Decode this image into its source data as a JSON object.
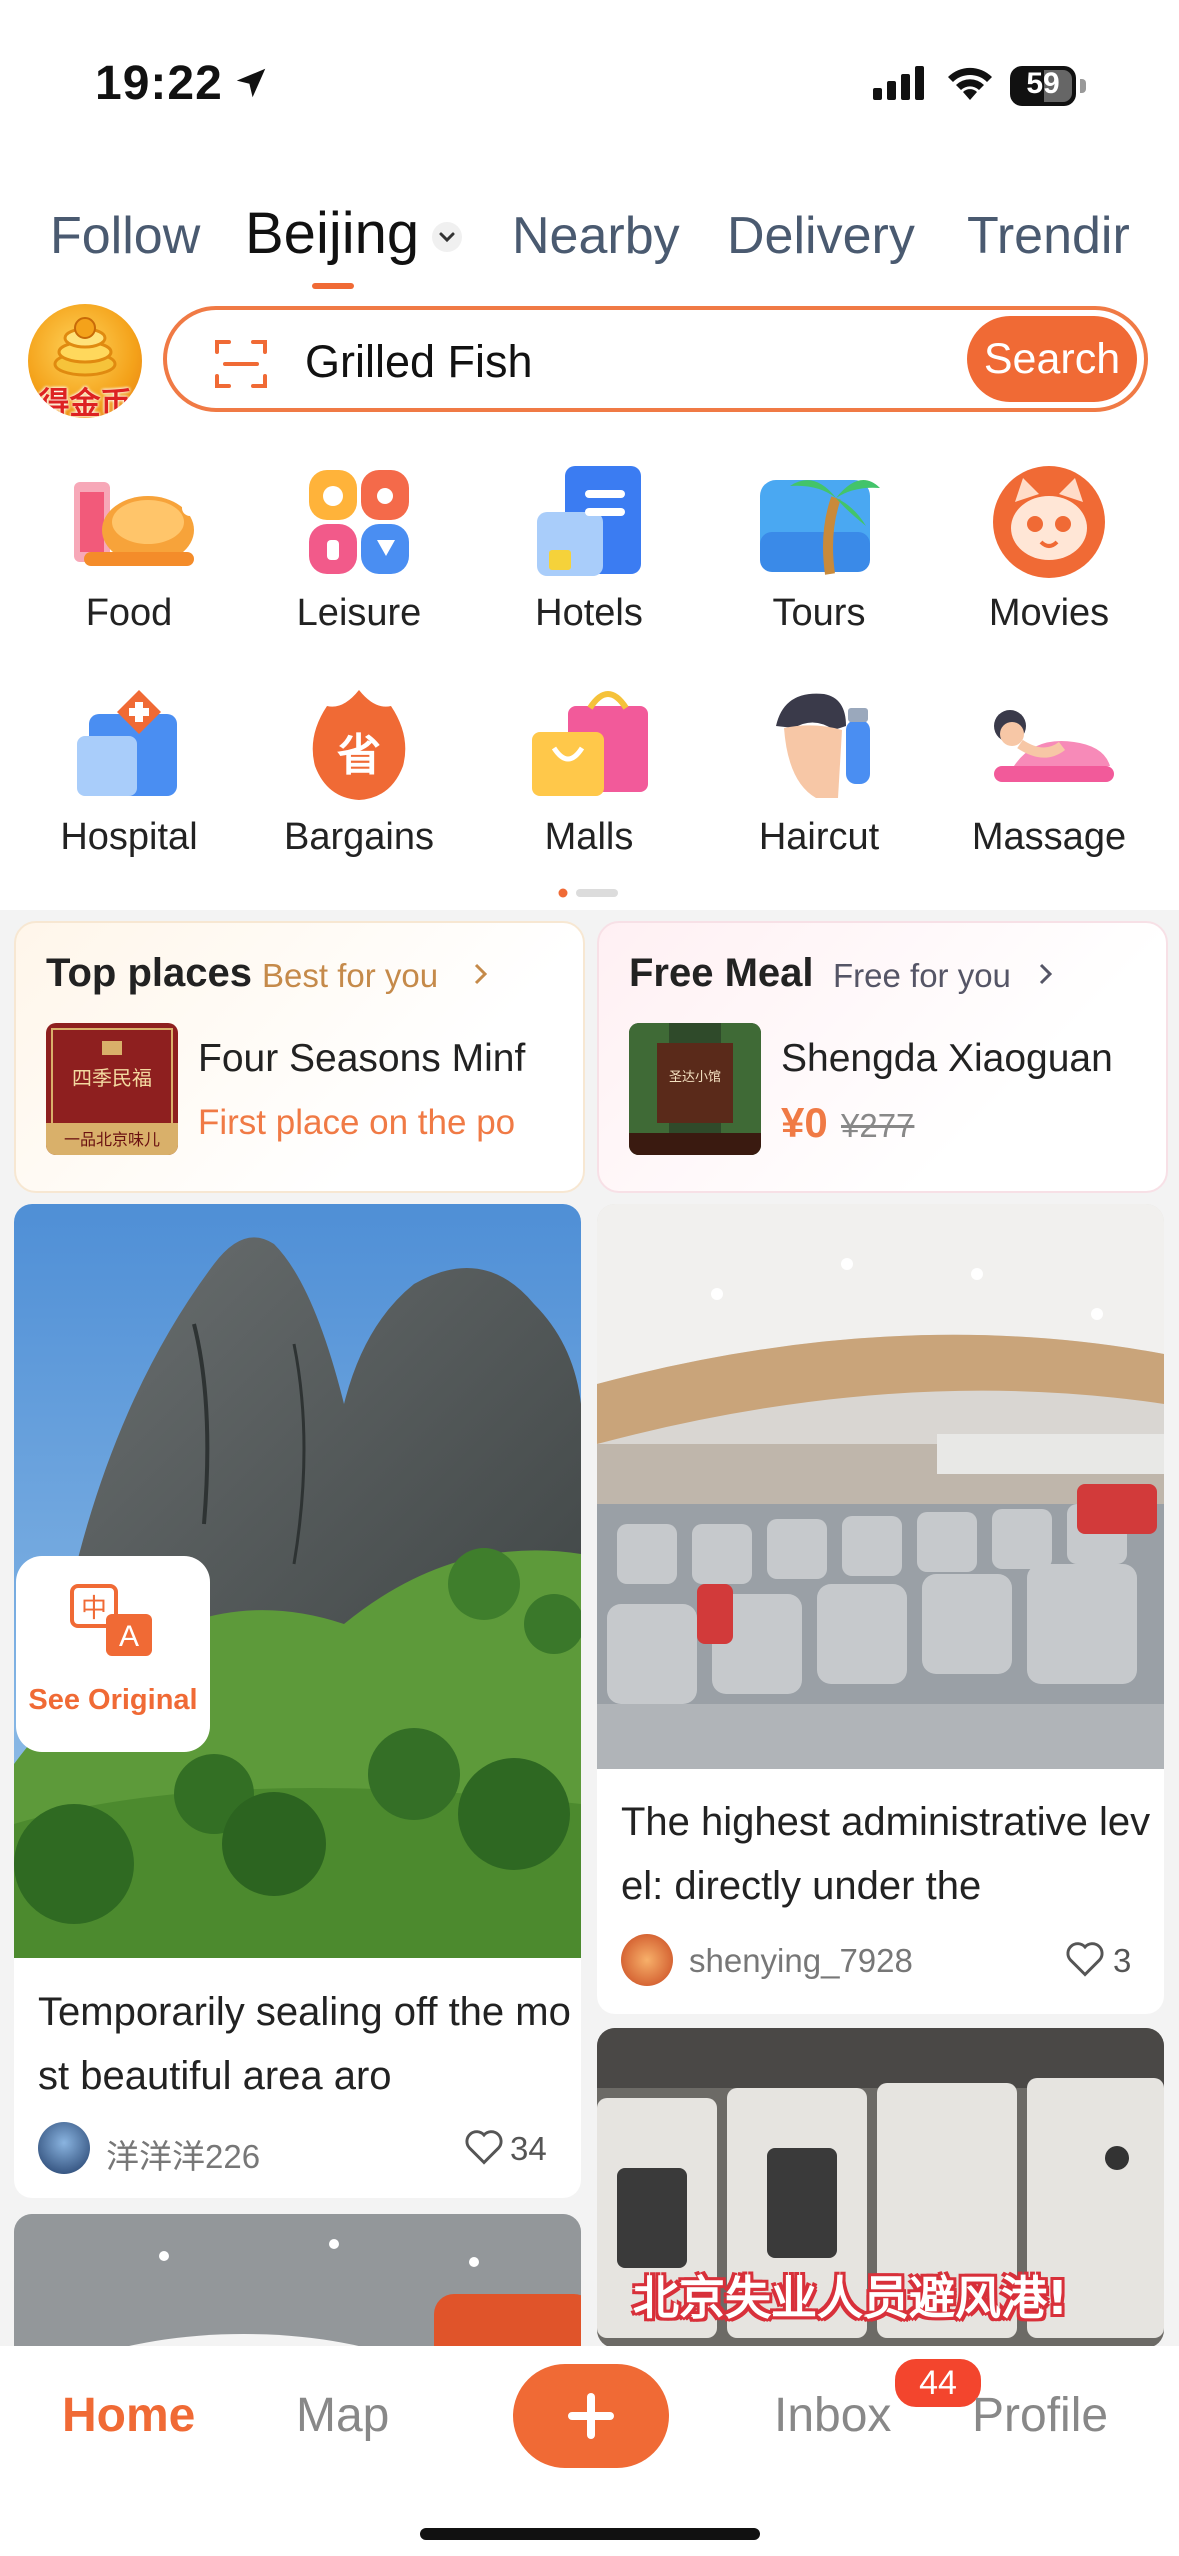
{
  "status_bar": {
    "time": "19:22",
    "battery": "59"
  },
  "tabs": [
    "Follow",
    "Beijing",
    "Nearby",
    "Delivery",
    "Trendir"
  ],
  "coin_badge_text": "得金币",
  "search": {
    "value": "Grilled Fish",
    "button": "Search"
  },
  "categories_row1": [
    "Food",
    "Leisure",
    "Hotels",
    "Tours",
    "Movies"
  ],
  "categories_row2": [
    "Hospital",
    "Bargains",
    "Malls",
    "Haircut",
    "Massage"
  ],
  "promo_top": {
    "title": "Top places",
    "subtitle": "Best for you",
    "name": "Four Seasons Minf",
    "desc": "First place on the po"
  },
  "promo_free": {
    "title": "Free Meal",
    "subtitle": "Free for you",
    "name": "Shengda Xiaoguan",
    "price": "¥0",
    "old_price": "¥277"
  },
  "feed": {
    "left1": {
      "badge": "See Original",
      "title": "Temporarily sealing off the most beautiful area aro",
      "user": "洋洋洋226",
      "likes": "34"
    },
    "right1": {
      "title": "The highest administrative level: directly under the",
      "user": "shenying_7928",
      "likes": "3"
    },
    "right2": {
      "overlay_text": "北京失业人员避风港!"
    }
  },
  "bottom_nav": {
    "home": "Home",
    "map": "Map",
    "inbox": "Inbox",
    "inbox_badge": "44",
    "profile": "Profile"
  },
  "colors": {
    "accent": "#f06a35"
  }
}
